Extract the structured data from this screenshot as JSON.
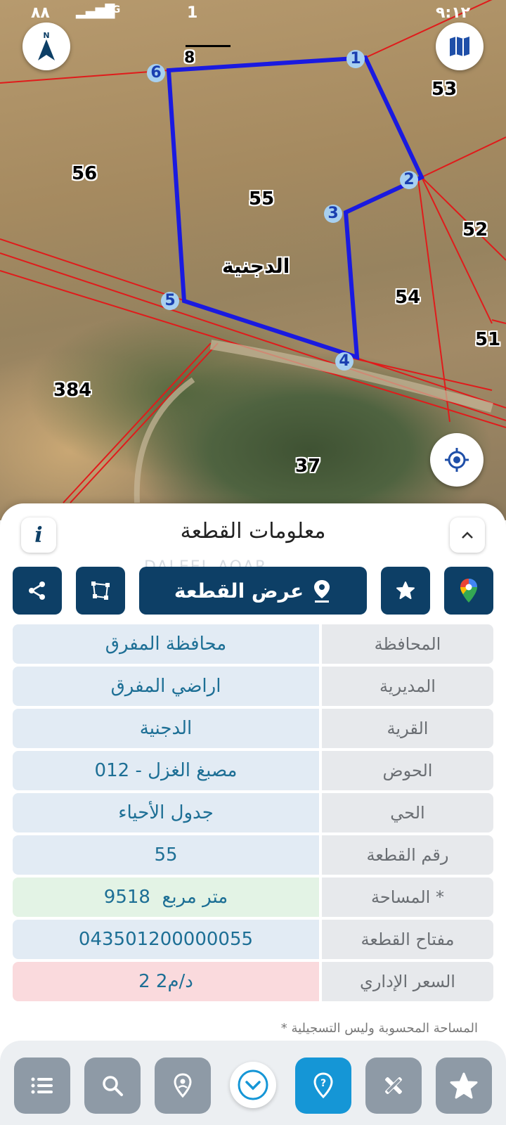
{
  "status_bar": {
    "left_text": "٨٨",
    "network": "4G",
    "extra": "1",
    "time": "٩:١٢"
  },
  "map": {
    "scale_label": "8",
    "village_label": "الدجنية",
    "parcels": [
      "53",
      "56",
      "55",
      "52",
      "54",
      "51",
      "384",
      "37"
    ],
    "vertices": [
      "1",
      "2",
      "3",
      "4",
      "5",
      "6"
    ],
    "parcel_color": "#e01b1b",
    "selected_color": "#1a1ae0"
  },
  "panel": {
    "title": "معلومات القطعة",
    "show_parcel_label": "عرض القطعة",
    "watermark": "DALEEL AQAR",
    "rows": [
      {
        "label": "المحافظة",
        "value": "محافظة المفرق"
      },
      {
        "label": "المديرية",
        "value": "اراضي المفرق"
      },
      {
        "label": "القرية",
        "value": "الدجنية"
      },
      {
        "label": "الحوض",
        "value": "مصبغ الغزل - 012"
      },
      {
        "label": "الحي",
        "value": "جدول الأحياء"
      },
      {
        "label": "رقم القطعة",
        "value": "55"
      },
      {
        "label": "المساحة *",
        "value": "9518  متر مربع"
      },
      {
        "label": "مفتاح القطعة",
        "value": "043501200000055"
      },
      {
        "label": "السعر الإداري",
        "value": "2 د/م2"
      }
    ],
    "note": "* المساحة المحسوبة وليس التسجيلية"
  },
  "colors": {
    "primary_dark": "#0d3f66",
    "value_text": "#1d6f95",
    "active_nav": "#1596d6",
    "nav_grey": "#8e9aa6"
  }
}
